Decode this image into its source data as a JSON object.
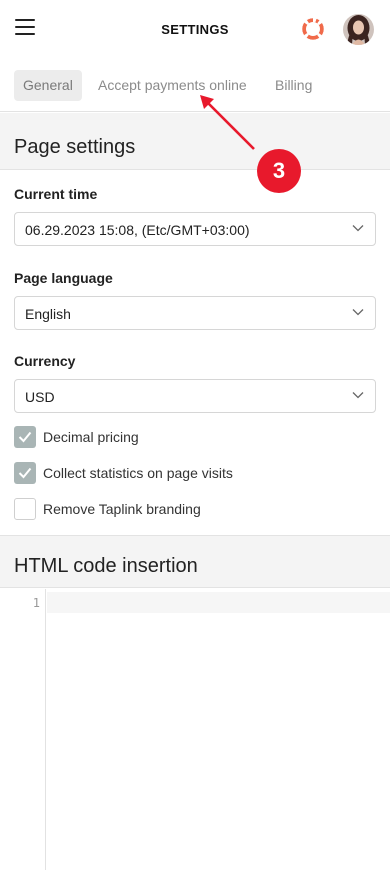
{
  "header": {
    "title": "SETTINGS"
  },
  "tabs": [
    {
      "label": "General",
      "active": true
    },
    {
      "label": "Accept payments online",
      "active": false
    },
    {
      "label": "Billing",
      "active": false
    }
  ],
  "page_settings": {
    "heading": "Page settings",
    "current_time": {
      "label": "Current time",
      "value": "06.29.2023 15:08, (Etc/GMT+03:00)"
    },
    "page_language": {
      "label": "Page language",
      "value": "English"
    },
    "currency": {
      "label": "Currency",
      "value": "USD"
    },
    "checkboxes": [
      {
        "label": "Decimal pricing",
        "checked": true
      },
      {
        "label": "Collect statistics on page visits",
        "checked": true
      },
      {
        "label": "Remove Taplink branding",
        "checked": false
      }
    ]
  },
  "html_code": {
    "heading": "HTML code insertion",
    "line_numbers": [
      "1"
    ]
  },
  "annotation": {
    "badge_number": "3",
    "color": "#e8192c"
  },
  "colors": {
    "checkbox_on": "#a9b5b5",
    "section_bg": "#f4f4f4",
    "accent_red": "#e8192c"
  }
}
